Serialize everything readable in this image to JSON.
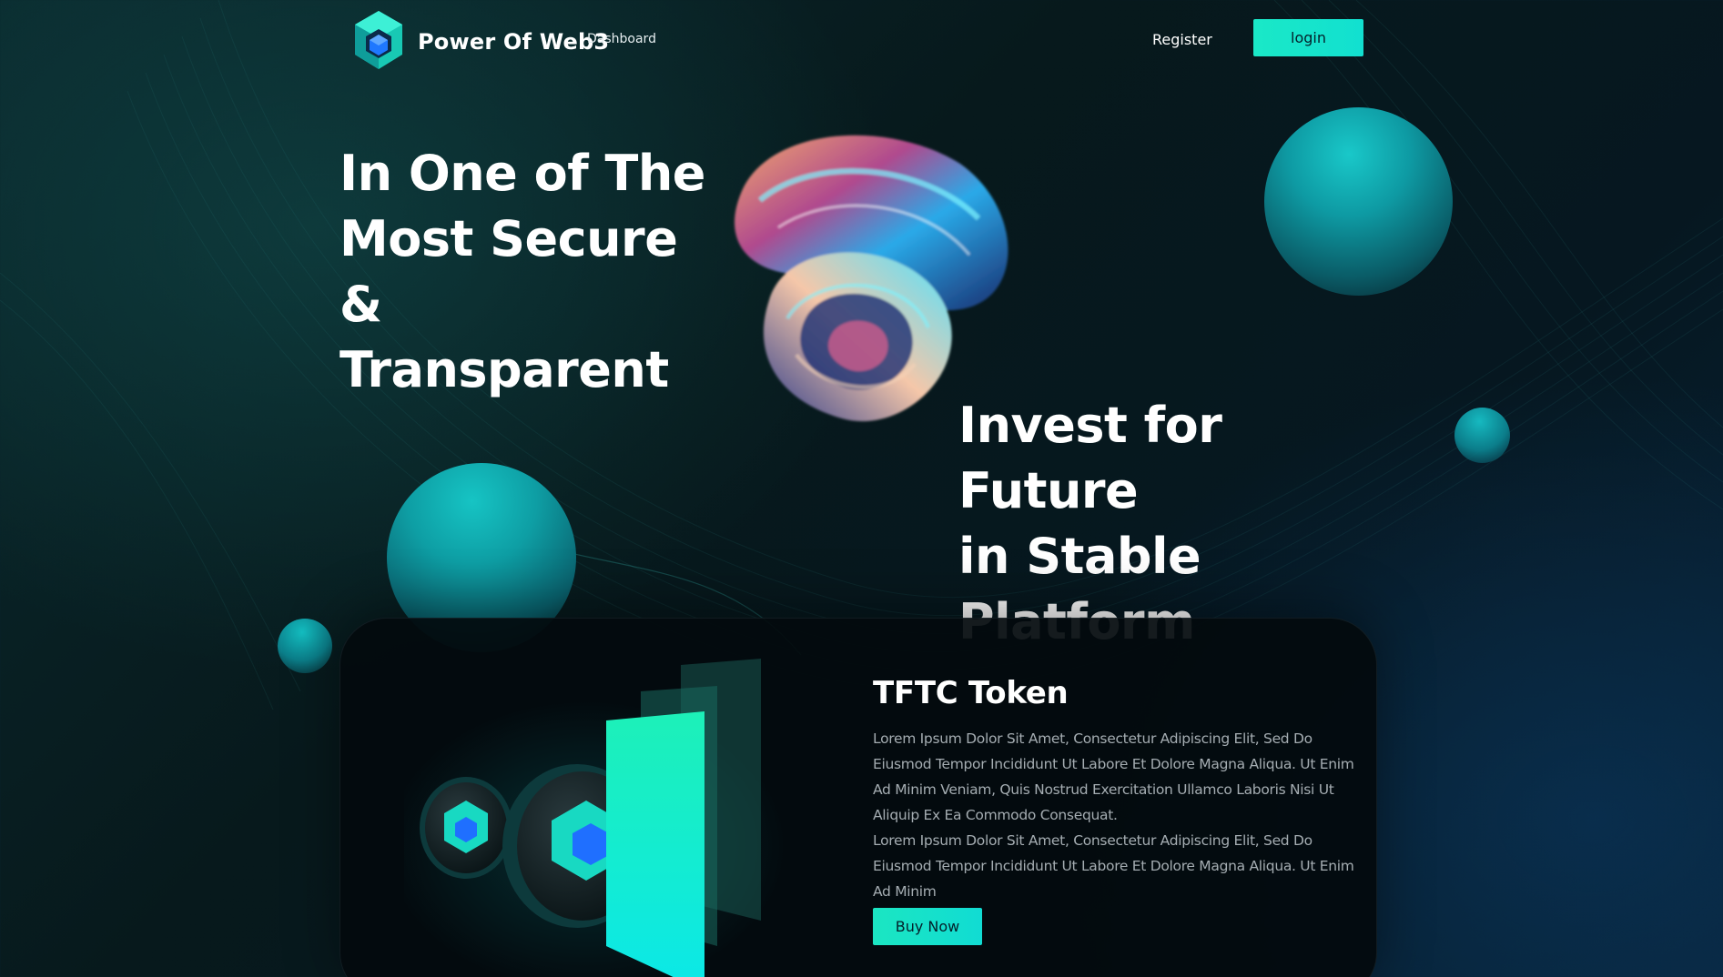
{
  "colors": {
    "accent": "#14e2c9",
    "background": "#07191c",
    "card": "#030a0d",
    "sphere": "#0e9aa3",
    "body_text": "#a5adb2"
  },
  "header": {
    "brand": "Power Of Web3",
    "logo_icon": "cube-logo-icon",
    "nav_dashboard": "Dashboard",
    "nav_register": "Register",
    "login_label": "login"
  },
  "hero": {
    "headline_left": [
      "In One of The",
      "Most Secure &",
      "Transparent"
    ],
    "headline_right": [
      "Invest for Future",
      "in Stable",
      "Platform"
    ],
    "decor_image": "abstract-fluid-swirl-image"
  },
  "token_card": {
    "title": "TFTC Token",
    "paragraphs": [
      "Lorem Ipsum Dolor Sit Amet, Consectetur Adipiscing Elit, Sed Do Eiusmod Tempor Incididunt Ut Labore Et Dolore Magna Aliqua. Ut Enim Ad Minim Veniam, Quis Nostrud Exercitation Ullamco Laboris Nisi Ut Aliquip Ex Ea Commodo Consequat.",
      "Lorem Ipsum Dolor Sit Amet, Consectetur Adipiscing Elit, Sed Do Eiusmod Tempor Incididunt Ut Labore Et Dolore Magna Aliqua. Ut Enim Ad Minim"
    ],
    "buy_label": "Buy Now",
    "art": "token-coins-illustration"
  }
}
